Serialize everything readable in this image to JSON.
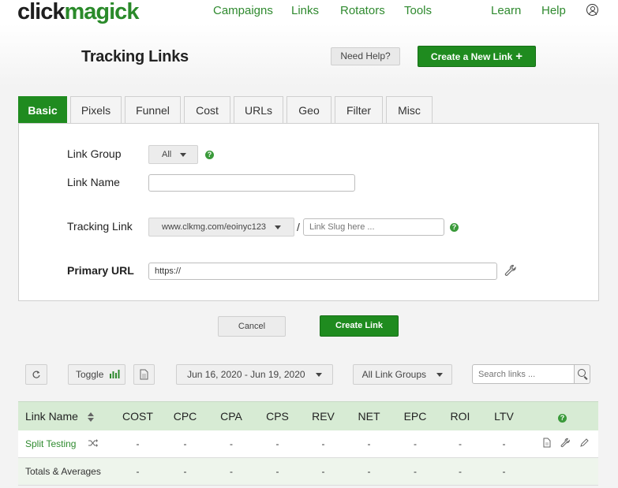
{
  "brand": {
    "logo_part1": "click",
    "logo_part2": "magick",
    "accent": "#1f8b1f"
  },
  "nav": {
    "items": [
      {
        "label": "Campaigns"
      },
      {
        "label": "Links"
      },
      {
        "label": "Rotators"
      },
      {
        "label": "Tools"
      },
      {
        "label": "Learn"
      },
      {
        "label": "Help"
      }
    ],
    "user_icon": "user-circle-icon"
  },
  "header": {
    "title": "Tracking Links",
    "help_label": "Need Help?",
    "create_label": "Create a New Link",
    "create_icon": "+"
  },
  "tabs": [
    {
      "label": "Basic",
      "active": true
    },
    {
      "label": "Pixels"
    },
    {
      "label": "Funnel"
    },
    {
      "label": "Cost"
    },
    {
      "label": "URLs"
    },
    {
      "label": "Geo"
    },
    {
      "label": "Filter"
    },
    {
      "label": "Misc"
    }
  ],
  "form": {
    "link_group_label": "Link Group",
    "link_group_value": "All",
    "link_name_label": "Link Name",
    "link_name_value": "",
    "tracking_link_label": "Tracking Link",
    "tracking_domain": "www.clkmg.com/eoinyc123",
    "slash": "/",
    "slug_placeholder": "Link Slug here ...",
    "primary_url_label": "Primary URL",
    "primary_url_value": "https://",
    "help_glyph": "?"
  },
  "actions": {
    "cancel_label": "Cancel",
    "create_label": "Create Link"
  },
  "toolbar": {
    "refresh_icon": "refresh-icon",
    "toggle_label": "Toggle",
    "date_range": "Jun 16, 2020 - Jun 19, 2020",
    "groups_label": "All Link Groups",
    "search_placeholder": "Search links ..."
  },
  "table": {
    "columns": [
      "Link Name",
      "COST",
      "CPC",
      "CPA",
      "CPS",
      "REV",
      "NET",
      "EPC",
      "ROI",
      "LTV"
    ],
    "help_glyph": "?",
    "rows": [
      {
        "name": "Split Testing",
        "values": [
          "-",
          "-",
          "-",
          "-",
          "-",
          "-",
          "-",
          "-",
          "-"
        ]
      }
    ],
    "totals": {
      "name": "Totals & Averages",
      "values": [
        "-",
        "-",
        "-",
        "-",
        "-",
        "-",
        "-",
        "-",
        "-"
      ]
    }
  }
}
